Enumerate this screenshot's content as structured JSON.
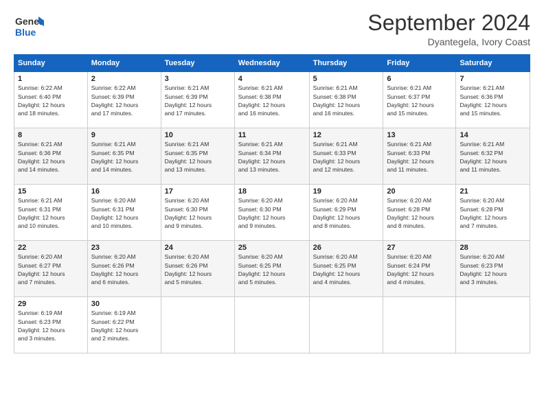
{
  "logo": {
    "line1": "General",
    "line2": "Blue"
  },
  "header": {
    "month": "September 2024",
    "location": "Dyantegela, Ivory Coast"
  },
  "days_of_week": [
    "Sunday",
    "Monday",
    "Tuesday",
    "Wednesday",
    "Thursday",
    "Friday",
    "Saturday"
  ],
  "weeks": [
    [
      {
        "day": "1",
        "info": "Sunrise: 6:22 AM\nSunset: 6:40 PM\nDaylight: 12 hours\nand 18 minutes."
      },
      {
        "day": "2",
        "info": "Sunrise: 6:22 AM\nSunset: 6:39 PM\nDaylight: 12 hours\nand 17 minutes."
      },
      {
        "day": "3",
        "info": "Sunrise: 6:21 AM\nSunset: 6:39 PM\nDaylight: 12 hours\nand 17 minutes."
      },
      {
        "day": "4",
        "info": "Sunrise: 6:21 AM\nSunset: 6:38 PM\nDaylight: 12 hours\nand 16 minutes."
      },
      {
        "day": "5",
        "info": "Sunrise: 6:21 AM\nSunset: 6:38 PM\nDaylight: 12 hours\nand 16 minutes."
      },
      {
        "day": "6",
        "info": "Sunrise: 6:21 AM\nSunset: 6:37 PM\nDaylight: 12 hours\nand 15 minutes."
      },
      {
        "day": "7",
        "info": "Sunrise: 6:21 AM\nSunset: 6:36 PM\nDaylight: 12 hours\nand 15 minutes."
      }
    ],
    [
      {
        "day": "8",
        "info": "Sunrise: 6:21 AM\nSunset: 6:36 PM\nDaylight: 12 hours\nand 14 minutes."
      },
      {
        "day": "9",
        "info": "Sunrise: 6:21 AM\nSunset: 6:35 PM\nDaylight: 12 hours\nand 14 minutes."
      },
      {
        "day": "10",
        "info": "Sunrise: 6:21 AM\nSunset: 6:35 PM\nDaylight: 12 hours\nand 13 minutes."
      },
      {
        "day": "11",
        "info": "Sunrise: 6:21 AM\nSunset: 6:34 PM\nDaylight: 12 hours\nand 13 minutes."
      },
      {
        "day": "12",
        "info": "Sunrise: 6:21 AM\nSunset: 6:33 PM\nDaylight: 12 hours\nand 12 minutes."
      },
      {
        "day": "13",
        "info": "Sunrise: 6:21 AM\nSunset: 6:33 PM\nDaylight: 12 hours\nand 11 minutes."
      },
      {
        "day": "14",
        "info": "Sunrise: 6:21 AM\nSunset: 6:32 PM\nDaylight: 12 hours\nand 11 minutes."
      }
    ],
    [
      {
        "day": "15",
        "info": "Sunrise: 6:21 AM\nSunset: 6:31 PM\nDaylight: 12 hours\nand 10 minutes."
      },
      {
        "day": "16",
        "info": "Sunrise: 6:20 AM\nSunset: 6:31 PM\nDaylight: 12 hours\nand 10 minutes."
      },
      {
        "day": "17",
        "info": "Sunrise: 6:20 AM\nSunset: 6:30 PM\nDaylight: 12 hours\nand 9 minutes."
      },
      {
        "day": "18",
        "info": "Sunrise: 6:20 AM\nSunset: 6:30 PM\nDaylight: 12 hours\nand 9 minutes."
      },
      {
        "day": "19",
        "info": "Sunrise: 6:20 AM\nSunset: 6:29 PM\nDaylight: 12 hours\nand 8 minutes."
      },
      {
        "day": "20",
        "info": "Sunrise: 6:20 AM\nSunset: 6:28 PM\nDaylight: 12 hours\nand 8 minutes."
      },
      {
        "day": "21",
        "info": "Sunrise: 6:20 AM\nSunset: 6:28 PM\nDaylight: 12 hours\nand 7 minutes."
      }
    ],
    [
      {
        "day": "22",
        "info": "Sunrise: 6:20 AM\nSunset: 6:27 PM\nDaylight: 12 hours\nand 7 minutes."
      },
      {
        "day": "23",
        "info": "Sunrise: 6:20 AM\nSunset: 6:26 PM\nDaylight: 12 hours\nand 6 minutes."
      },
      {
        "day": "24",
        "info": "Sunrise: 6:20 AM\nSunset: 6:26 PM\nDaylight: 12 hours\nand 5 minutes."
      },
      {
        "day": "25",
        "info": "Sunrise: 6:20 AM\nSunset: 6:25 PM\nDaylight: 12 hours\nand 5 minutes."
      },
      {
        "day": "26",
        "info": "Sunrise: 6:20 AM\nSunset: 6:25 PM\nDaylight: 12 hours\nand 4 minutes."
      },
      {
        "day": "27",
        "info": "Sunrise: 6:20 AM\nSunset: 6:24 PM\nDaylight: 12 hours\nand 4 minutes."
      },
      {
        "day": "28",
        "info": "Sunrise: 6:20 AM\nSunset: 6:23 PM\nDaylight: 12 hours\nand 3 minutes."
      }
    ],
    [
      {
        "day": "29",
        "info": "Sunrise: 6:19 AM\nSunset: 6:23 PM\nDaylight: 12 hours\nand 3 minutes."
      },
      {
        "day": "30",
        "info": "Sunrise: 6:19 AM\nSunset: 6:22 PM\nDaylight: 12 hours\nand 2 minutes."
      },
      {
        "day": "",
        "info": ""
      },
      {
        "day": "",
        "info": ""
      },
      {
        "day": "",
        "info": ""
      },
      {
        "day": "",
        "info": ""
      },
      {
        "day": "",
        "info": ""
      }
    ]
  ]
}
